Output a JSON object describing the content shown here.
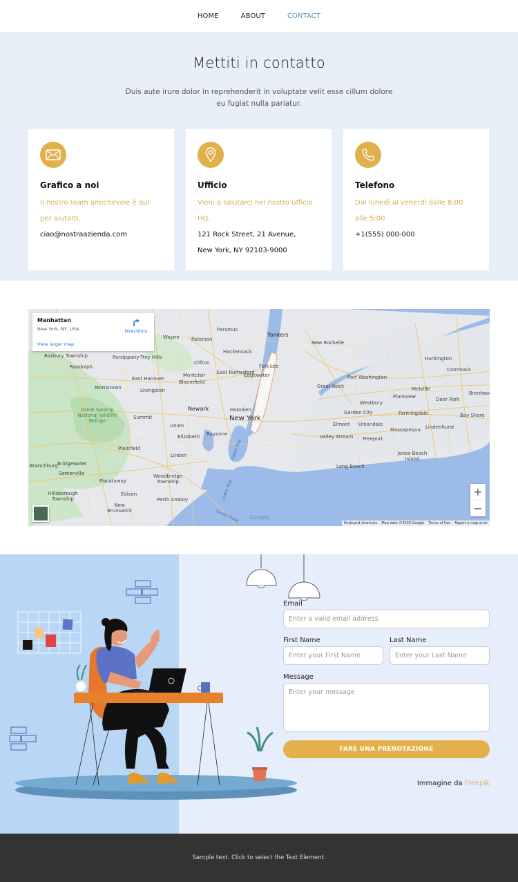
{
  "nav": {
    "items": [
      {
        "label": "HOME",
        "active": false
      },
      {
        "label": "ABOUT",
        "active": false
      },
      {
        "label": "CONTACT",
        "active": true
      }
    ]
  },
  "contact": {
    "title": "Mettiti in contatto",
    "subtitle": "Duis aute irure dolor in reprehenderit in voluptate velit esse cillum dolore eu fugiat nulla pariatur.",
    "accent_color": "#e0b04b",
    "cards": [
      {
        "icon": "envelope-icon",
        "title": "Grafico a noi",
        "description": "Il nostro team amichevole è qui per aiutarti.",
        "info": [
          "ciao@nostraazienda.com"
        ]
      },
      {
        "icon": "map-pin-icon",
        "title": "Ufficio",
        "description": "Vieni a salutarci nel nostro ufficio HQ.",
        "info": [
          "121 Rock Street, 21 Avenue,",
          "New York, NY 92103-9000"
        ]
      },
      {
        "icon": "phone-icon",
        "title": "Telefono",
        "description": "Dal lunedì al venerdì dalle 8:00 alle 5:00",
        "info": [
          "+1(555) 000-000"
        ]
      }
    ]
  },
  "map": {
    "place_name": "Manhattan",
    "place_address": "New York, NY, USA",
    "directions_label": "Directions",
    "larger_map_label": "View larger map",
    "zoom_in": "+",
    "zoom_out": "−",
    "attribution": [
      "Keyboard shortcuts",
      "Map data ©2023 Google",
      "Terms of Use",
      "Report a map error"
    ],
    "logo": "Google",
    "labels": [
      {
        "text": "Yonkers"
      },
      {
        "text": "Paterson"
      },
      {
        "text": "Paramus"
      },
      {
        "text": "Wayne"
      },
      {
        "text": "Hackensack"
      },
      {
        "text": "New Rochelle"
      },
      {
        "text": "Huntington"
      },
      {
        "text": "Roxbury Township"
      },
      {
        "text": "Parsippany-Troy Hills"
      },
      {
        "text": "Clifton"
      },
      {
        "text": "Fort Lee"
      },
      {
        "text": "Randolph"
      },
      {
        "text": "East Hanover"
      },
      {
        "text": "Montclair"
      },
      {
        "text": "East Rutherford"
      },
      {
        "text": "Edgewater"
      },
      {
        "text": "Port Washington"
      },
      {
        "text": "Commack"
      },
      {
        "text": "Morristown"
      },
      {
        "text": "Livingston"
      },
      {
        "text": "Bloomfield"
      },
      {
        "text": "Great Neck"
      },
      {
        "text": "Melville"
      },
      {
        "text": "Plainview"
      },
      {
        "text": "Brentwood"
      },
      {
        "text": "Deer Park"
      },
      {
        "text": "Westbury"
      },
      {
        "text": "Hoboken"
      },
      {
        "text": "Newark"
      },
      {
        "text": "Great Swamp National Wildlife Refuge"
      },
      {
        "text": "Summit"
      },
      {
        "text": "New York"
      },
      {
        "text": "Garden City"
      },
      {
        "text": "Farmingdale"
      },
      {
        "text": "Bay Shore"
      },
      {
        "text": "Union"
      },
      {
        "text": "Elmont"
      },
      {
        "text": "Uniondale"
      },
      {
        "text": "Massapequa"
      },
      {
        "text": "Lindenhurst"
      },
      {
        "text": "Elizabeth"
      },
      {
        "text": "Bayonne"
      },
      {
        "text": "Valley Stream"
      },
      {
        "text": "Freeport"
      },
      {
        "text": "Plainfield"
      },
      {
        "text": "Linden"
      },
      {
        "text": "Jones Beach Island"
      },
      {
        "text": "Long Beach"
      },
      {
        "text": "Branchburg"
      },
      {
        "text": "Bridgewater"
      },
      {
        "text": "Somerville"
      },
      {
        "text": "Piscataway"
      },
      {
        "text": "Woodbridge Township"
      },
      {
        "text": "Hillsborough Township"
      },
      {
        "text": "Edison"
      },
      {
        "text": "Perth Amboy"
      },
      {
        "text": "New Brunswick"
      },
      {
        "text": "Upper Bay"
      },
      {
        "text": "Lower Bay"
      },
      {
        "text": "Sandy Hook"
      }
    ]
  },
  "form": {
    "email_label": "Email",
    "email_placeholder": "Enter a valid email address",
    "first_name_label": "First Name",
    "first_name_placeholder": "Enter your First Name",
    "last_name_label": "Last Name",
    "last_name_placeholder": "Enter your Last Name",
    "message_label": "Message",
    "message_placeholder": "Enter your message",
    "submit_label": "FARE UNA PRENOTAZIONE",
    "credit_text": "Immagine da",
    "credit_link": "Freepik"
  },
  "footer": {
    "text": "Sample text. Click to select the Text Element."
  }
}
